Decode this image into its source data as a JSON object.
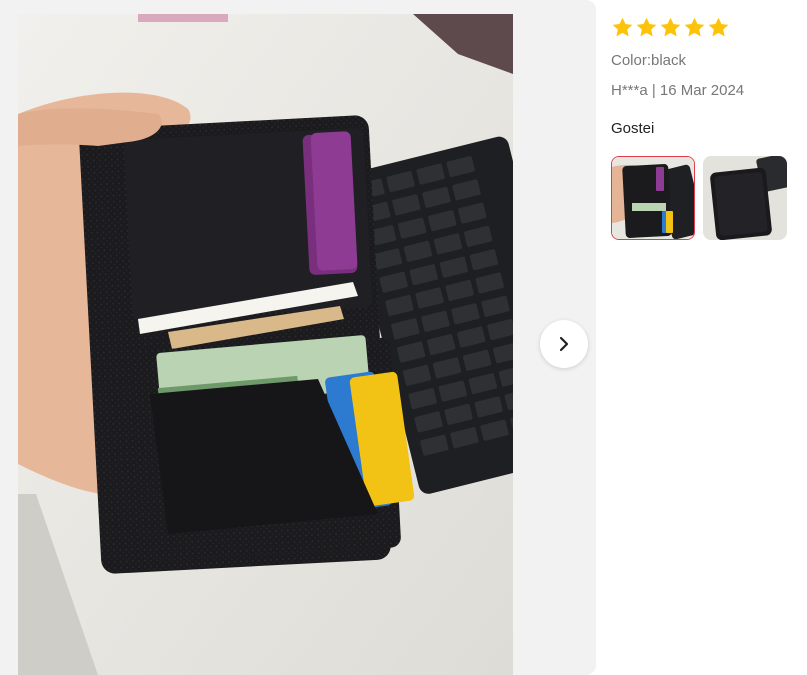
{
  "review": {
    "rating": 5,
    "stars": [
      1,
      2,
      3,
      4,
      5
    ],
    "star_color": "#fdc30b",
    "color_label": "Color:black",
    "author_date": "H***a | 16 Mar 2024",
    "text": "Gostei"
  },
  "gallery": {
    "next_icon": "chevron-right-icon",
    "thumbnails": [
      "open-wallet-photo",
      "closed-wallet-photo"
    ],
    "selected_index": 0
  },
  "colors": {
    "selected_border": "#e23b4a",
    "panel_bg": "#f2f2f2"
  }
}
